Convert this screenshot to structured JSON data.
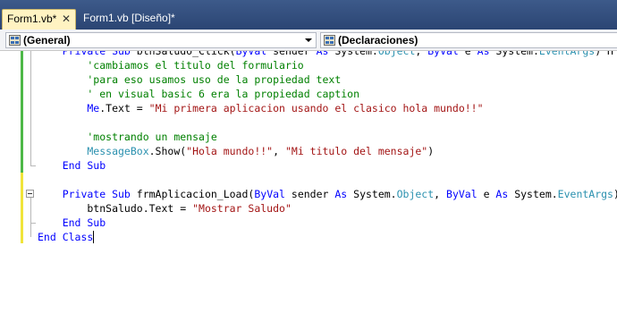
{
  "tabs": [
    {
      "label": "Form1.vb*",
      "close": "✕"
    },
    {
      "label": "Form1.vb [Diseño]*"
    }
  ],
  "navbar": {
    "left_combo": "(General)",
    "right_combo": "(Declaraciones)"
  },
  "code_lines": [
    [
      {
        "c": "kw",
        "t": "    Private Sub "
      },
      {
        "c": "",
        "t": "btnSaludo_Click("
      },
      {
        "c": "kw",
        "t": "ByVal "
      },
      {
        "c": "",
        "t": "sender "
      },
      {
        "c": "kw",
        "t": "As "
      },
      {
        "c": "",
        "t": "System."
      },
      {
        "c": "ty",
        "t": "Object"
      },
      {
        "c": "",
        "t": ", "
      },
      {
        "c": "kw",
        "t": "ByVal "
      },
      {
        "c": "",
        "t": "e "
      },
      {
        "c": "kw",
        "t": "As "
      },
      {
        "c": "",
        "t": "System."
      },
      {
        "c": "ty",
        "t": "EventArgs"
      },
      {
        "c": "",
        "t": ") H"
      }
    ],
    [
      {
        "c": "cm",
        "t": "        'cambiamos el titulo del formulario"
      }
    ],
    [
      {
        "c": "cm",
        "t": "        'para eso usamos uso de la propiedad text"
      }
    ],
    [
      {
        "c": "cm",
        "t": "        ' en visual basic 6 era la propiedad caption"
      }
    ],
    [
      {
        "c": "kw",
        "t": "        Me"
      },
      {
        "c": "",
        "t": ".Text = "
      },
      {
        "c": "st",
        "t": "\"Mi primera aplicacion usando el clasico hola mundo!!\""
      }
    ],
    [
      {
        "c": "",
        "t": " "
      }
    ],
    [
      {
        "c": "cm",
        "t": "        'mostrando un mensaje"
      }
    ],
    [
      {
        "c": "ty",
        "t": "        MessageBox"
      },
      {
        "c": "",
        "t": ".Show("
      },
      {
        "c": "st",
        "t": "\"Hola mundo!!\""
      },
      {
        "c": "",
        "t": ", "
      },
      {
        "c": "st",
        "t": "\"Mi titulo del mensaje\""
      },
      {
        "c": "",
        "t": ")"
      }
    ],
    [
      {
        "c": "kw",
        "t": "    End Sub"
      }
    ],
    [
      {
        "c": "",
        "t": " "
      }
    ],
    [
      {
        "c": "kw",
        "t": "    Private Sub "
      },
      {
        "c": "",
        "t": "frmAplicacion_Load("
      },
      {
        "c": "kw",
        "t": "ByVal "
      },
      {
        "c": "",
        "t": "sender "
      },
      {
        "c": "kw",
        "t": "As "
      },
      {
        "c": "",
        "t": "System."
      },
      {
        "c": "ty",
        "t": "Object"
      },
      {
        "c": "",
        "t": ", "
      },
      {
        "c": "kw",
        "t": "ByVal "
      },
      {
        "c": "",
        "t": "e "
      },
      {
        "c": "kw",
        "t": "As "
      },
      {
        "c": "",
        "t": "System."
      },
      {
        "c": "ty",
        "t": "EventArgs"
      },
      {
        "c": "",
        "t": ")"
      }
    ],
    [
      {
        "c": "",
        "t": "        btnSaludo.Text = "
      },
      {
        "c": "st",
        "t": "\"Mostrar Saludo\""
      }
    ],
    [
      {
        "c": "kw",
        "t": "    End Sub"
      }
    ],
    [
      {
        "c": "kw",
        "t": "End Class"
      }
    ]
  ],
  "colors": {
    "keyword": "#0000ff",
    "comment": "#008000",
    "string": "#a31515",
    "type": "#2b91af",
    "changed_saved": "#4db848",
    "changed_unsaved": "#f0e43a"
  }
}
